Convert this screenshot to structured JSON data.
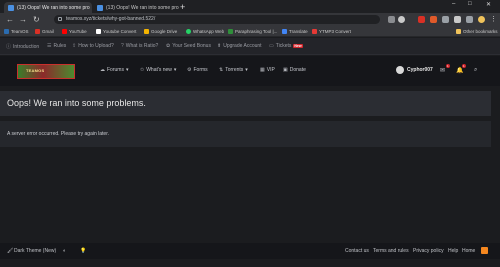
{
  "browser": {
    "tabs": [
      {
        "title": "(13) Oops! We ran into some pro",
        "active": true
      },
      {
        "title": "(13) Oops! We ran into some pro",
        "active": false
      }
    ],
    "new_tab": "+",
    "window_controls": [
      "–",
      "□",
      "✕"
    ],
    "url": "teamos.xyz/tickets/why-got-banned.522/",
    "bookmarks": [
      {
        "label": "TeamOS",
        "icon": "teamos-icon",
        "color": "#2b6cb0"
      },
      {
        "label": "Gmail",
        "icon": "gmail-icon",
        "color": "#d93025"
      },
      {
        "label": "YouTube",
        "icon": "youtube-icon",
        "color": "#ff0000"
      },
      {
        "label": "Youtube Convert",
        "icon": "youtube-convert-icon",
        "color": "#ffffff"
      },
      {
        "label": "Google Drive",
        "icon": "google-drive-icon",
        "color": "#f4b400"
      },
      {
        "label": "WhatsApp Web",
        "icon": "whatsapp-icon",
        "color": "#25d366"
      },
      {
        "label": "Paraphrasing Tool |...",
        "icon": "quillbot-icon",
        "color": "#2f8f3a"
      },
      {
        "label": "Translate",
        "icon": "translate-icon",
        "color": "#4285f4"
      },
      {
        "label": "YTMP3 Convert",
        "icon": "ytmp3-icon",
        "color": "#e53935"
      }
    ],
    "other_bookmarks": "Other bookmarks"
  },
  "site": {
    "top_links": [
      {
        "label": "Introduction",
        "icon": "info-icon"
      },
      {
        "label": "Rules",
        "icon": "rules-icon"
      },
      {
        "label": "How to Upload?",
        "icon": "upload-icon"
      },
      {
        "label": "What is Ratio?",
        "icon": "question-icon"
      },
      {
        "label": "Your Seed Bonus",
        "icon": "seed-icon"
      },
      {
        "label": "Upgrade Account",
        "icon": "upgrade-icon"
      },
      {
        "label": "Tickets",
        "icon": "ticket-icon",
        "badge": "New"
      }
    ],
    "logo_text": "TEAMOS",
    "nav": [
      {
        "label": "Forums",
        "icon": "forums-icon",
        "caret": "▾"
      },
      {
        "label": "What's new",
        "icon": "star-icon",
        "caret": "▾"
      },
      {
        "label": "Forms",
        "icon": "forms-icon",
        "caret": ""
      },
      {
        "label": "Torrents",
        "icon": "torrents-icon",
        "caret": "▾"
      },
      {
        "label": "VIP",
        "icon": "vip-icon",
        "caret": ""
      },
      {
        "label": "Donate",
        "icon": "donate-icon",
        "caret": ""
      }
    ],
    "user": {
      "name": "Cyphor007"
    },
    "header_badges": {
      "messages": "1",
      "alerts": "1"
    }
  },
  "error": {
    "title": "Oops! We ran into some problems.",
    "message": "A server error occurred. Please try again later."
  },
  "footer": {
    "theme": "Dark Theme (New)",
    "links": [
      "Contact us",
      "Terms and rules",
      "Privacy policy",
      "Help",
      "Home"
    ]
  },
  "colors": {
    "accent": "#d2262c",
    "page_bg": "#1b1c1f",
    "panel_bg": "#2b2d33"
  }
}
